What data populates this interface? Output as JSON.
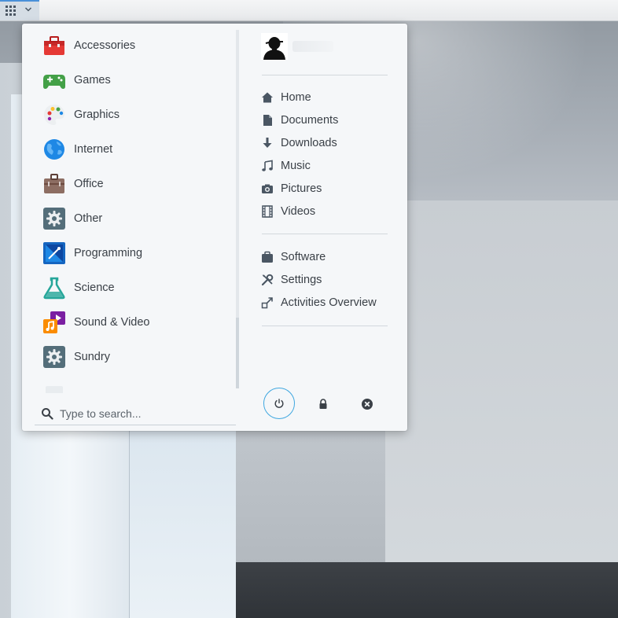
{
  "menu": {
    "categories": [
      {
        "label": "Accessories",
        "icon": "toolbox-icon"
      },
      {
        "label": "Games",
        "icon": "gamepad-icon"
      },
      {
        "label": "Graphics",
        "icon": "palette-icon"
      },
      {
        "label": "Internet",
        "icon": "globe-icon"
      },
      {
        "label": "Office",
        "icon": "briefcase-icon"
      },
      {
        "label": "Other",
        "icon": "gear-icon"
      },
      {
        "label": "Programming",
        "icon": "programming-icon"
      },
      {
        "label": "Science",
        "icon": "flask-icon"
      },
      {
        "label": "Sound & Video",
        "icon": "media-icon"
      },
      {
        "label": "Sundry",
        "icon": "gear-icon"
      }
    ],
    "search": {
      "placeholder": "Type to search..."
    },
    "places": [
      {
        "label": "Home",
        "icon": "home-icon"
      },
      {
        "label": "Documents",
        "icon": "document-icon"
      },
      {
        "label": "Downloads",
        "icon": "download-icon"
      },
      {
        "label": "Music",
        "icon": "music-icon"
      },
      {
        "label": "Pictures",
        "icon": "camera-icon"
      },
      {
        "label": "Videos",
        "icon": "film-icon"
      }
    ],
    "system": [
      {
        "label": "Software",
        "icon": "software-icon"
      },
      {
        "label": "Settings",
        "icon": "settings-tools-icon"
      },
      {
        "label": "Activities Overview",
        "icon": "activities-icon"
      }
    ],
    "session": [
      {
        "action": "power-off",
        "icon": "power-icon"
      },
      {
        "action": "lock",
        "icon": "lock-icon"
      },
      {
        "action": "log-out",
        "icon": "close-circle-icon"
      }
    ]
  },
  "colors": {
    "accent": "#3fa7e0",
    "panel_highlight": "#4a90d9",
    "text": "#3a4047",
    "icon": "#4a5663"
  }
}
